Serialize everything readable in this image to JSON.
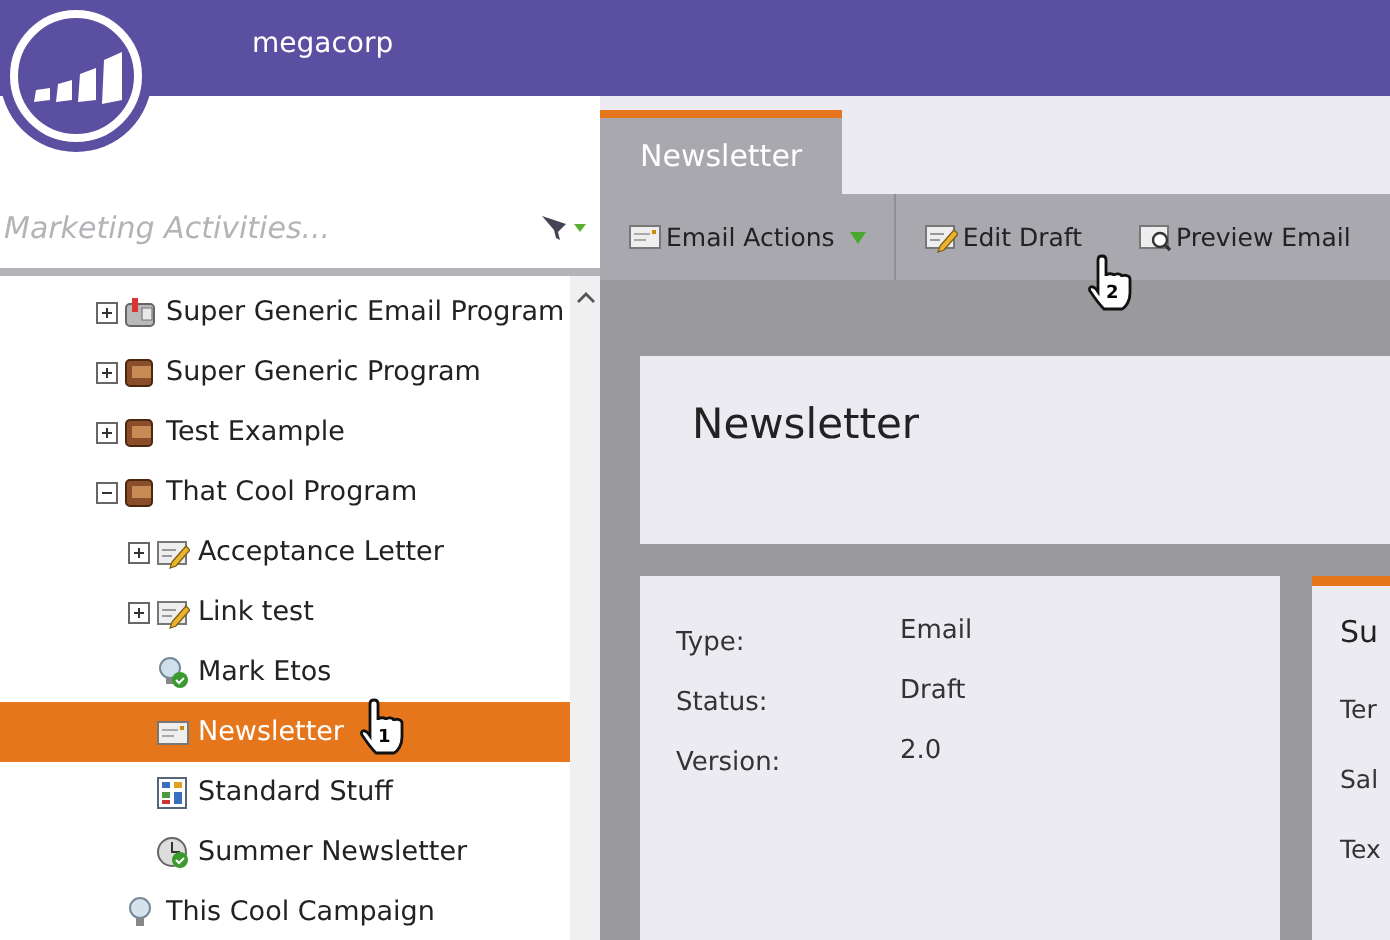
{
  "header": {
    "workspace": "megacorp"
  },
  "sidebar": {
    "search": {
      "placeholder": "Marketing Activities..."
    },
    "tree": [
      {
        "label": "Super Generic Email Program",
        "kind": "email-program",
        "expanded": false,
        "selected": false
      },
      {
        "label": "Super Generic Program",
        "kind": "program",
        "expanded": false,
        "selected": false
      },
      {
        "label": "Test Example",
        "kind": "program",
        "expanded": false,
        "selected": false
      },
      {
        "label": "That Cool Program",
        "kind": "program",
        "expanded": true,
        "selected": false,
        "children": [
          {
            "label": "Acceptance Letter",
            "kind": "draft",
            "expanded": false,
            "selected": false
          },
          {
            "label": "Link test",
            "kind": "draft",
            "expanded": false,
            "selected": false
          },
          {
            "label": "Mark Etos",
            "kind": "campaign-active",
            "selected": false
          },
          {
            "label": "Newsletter",
            "kind": "email",
            "selected": true
          },
          {
            "label": "Standard Stuff",
            "kind": "report",
            "selected": false
          },
          {
            "label": "Summer Newsletter",
            "kind": "clock-active",
            "selected": false
          }
        ]
      },
      {
        "label": "This Cool Campaign",
        "kind": "campaign",
        "selected": false
      }
    ]
  },
  "tabs": [
    {
      "label": "Newsletter",
      "selected": true
    }
  ],
  "toolbar": [
    {
      "label": "Email Actions",
      "kind": "menu"
    },
    {
      "label": "Edit Draft",
      "kind": "edit"
    },
    {
      "label": "Preview Email",
      "kind": "preview"
    }
  ],
  "title": "Newsletter",
  "details": [
    {
      "label": "Type:",
      "value": "Email"
    },
    {
      "label": "Status:",
      "value": "Draft"
    },
    {
      "label": "Version:",
      "value": "2.0"
    }
  ],
  "summary": {
    "title": "Su",
    "rows": [
      "Ter",
      "Sal",
      "Tex"
    ]
  },
  "cursors": [
    {
      "number": "1"
    },
    {
      "number": "2"
    }
  ]
}
